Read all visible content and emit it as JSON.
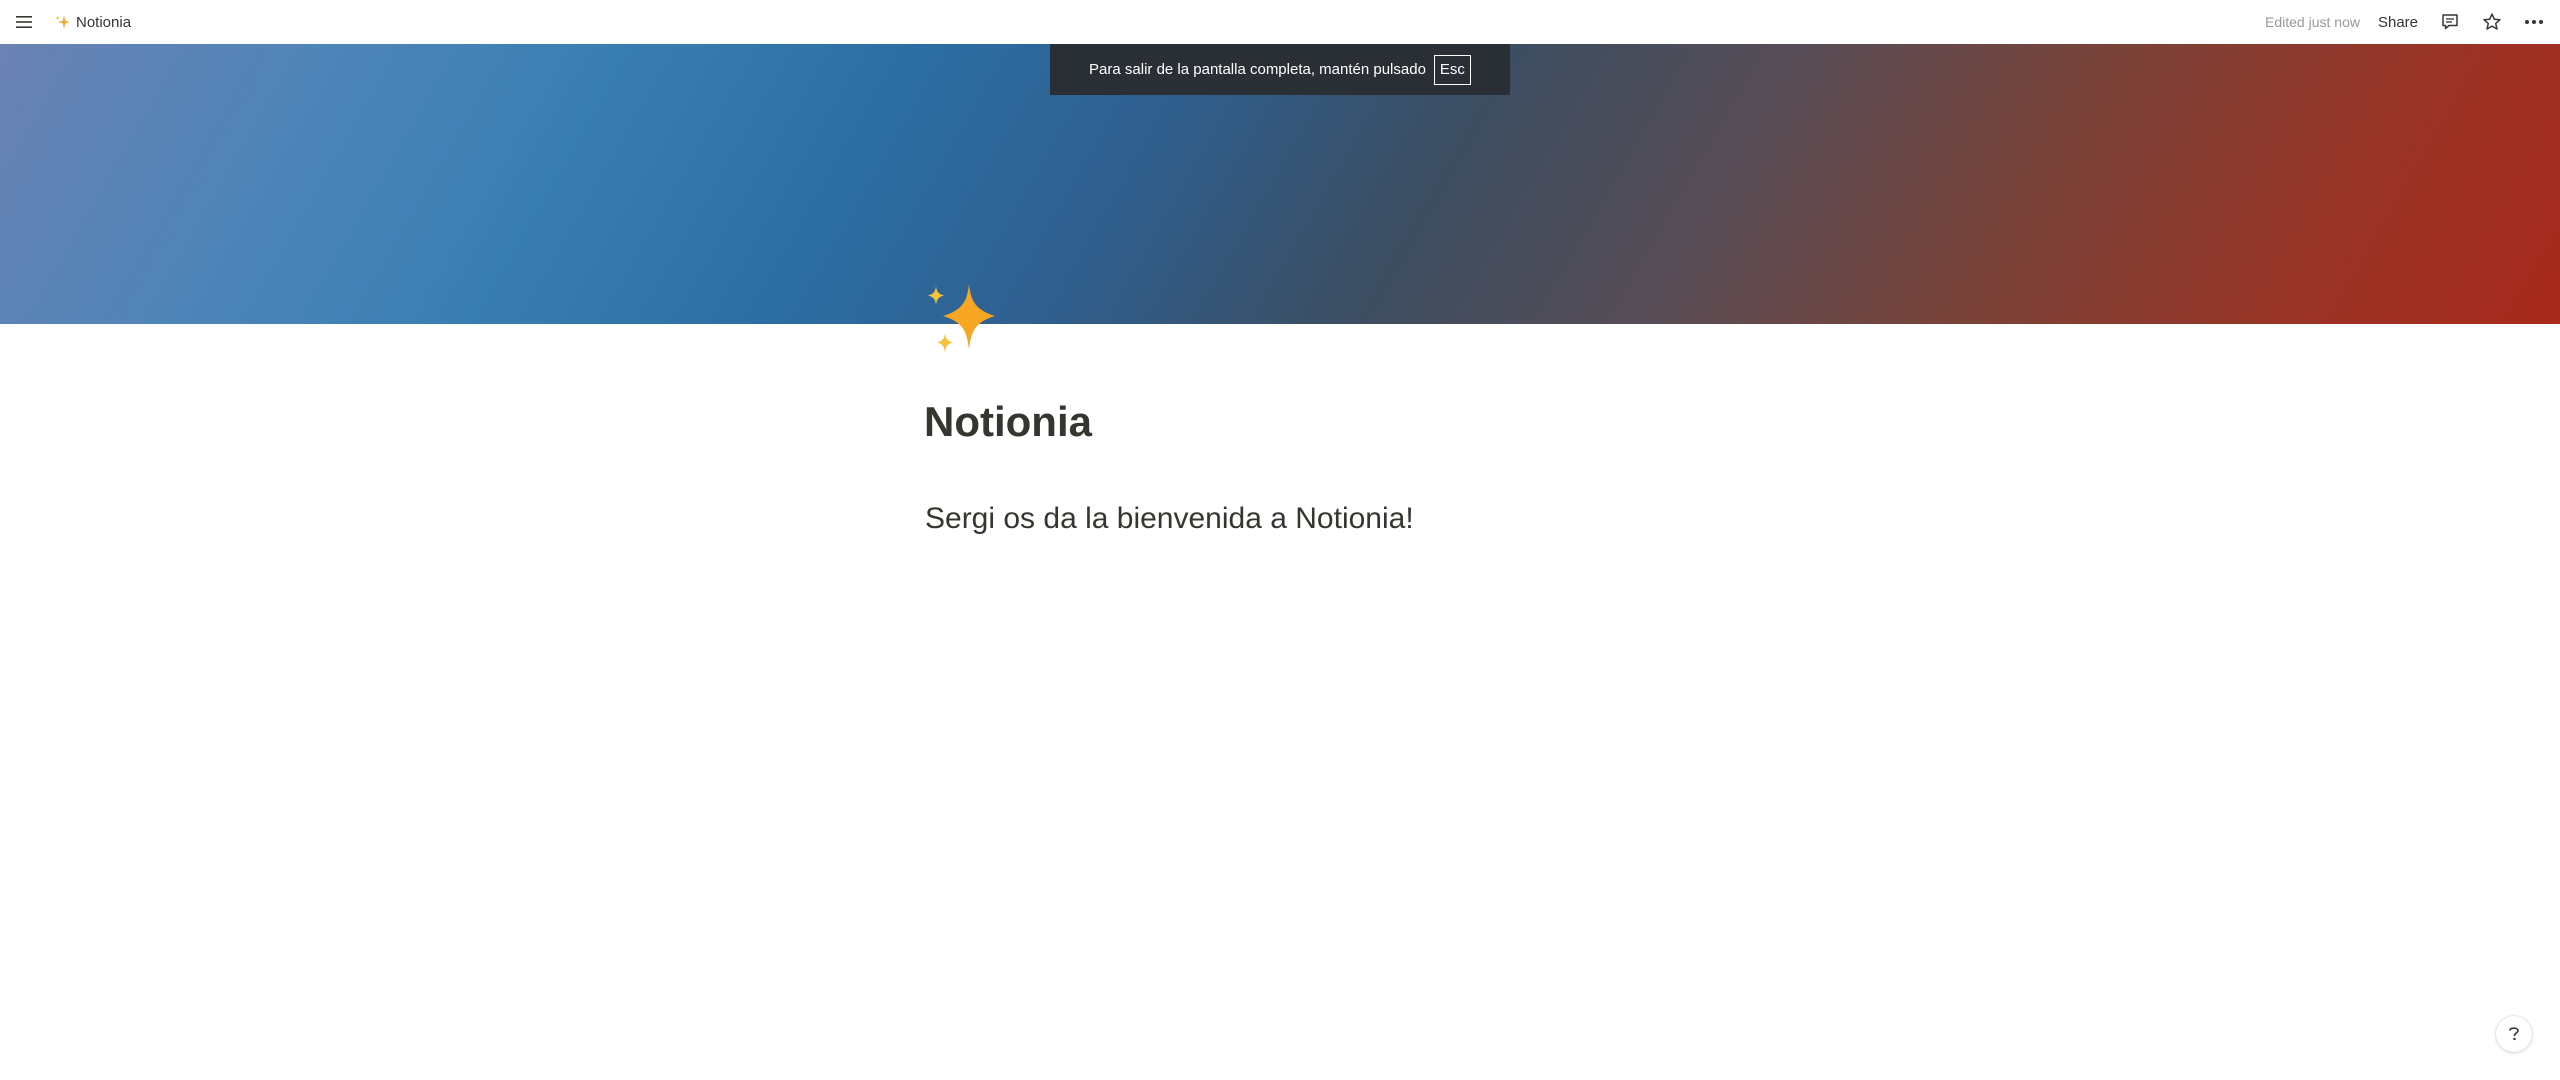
{
  "topbar": {
    "breadcrumb": {
      "icon": "sparkles-icon",
      "label": "Notionia"
    },
    "edited_status": "Edited just now",
    "share_label": "Share"
  },
  "fullscreen_notice": {
    "message": "Para salir de la pantalla completa, mantén pulsado",
    "key": "Esc"
  },
  "page": {
    "icon": "sparkles-icon",
    "title": "Notionia",
    "blocks": [
      {
        "type": "heading",
        "text": "Sergi os da la bienvenida a Notionia!"
      }
    ]
  },
  "colors": {
    "text": "#37352f",
    "muted": "#9b9a97",
    "sparkle": "#f6a623",
    "toast_bg": "#2a2e35",
    "cover_start": "#6b82b4",
    "cover_end": "#a8291d"
  }
}
